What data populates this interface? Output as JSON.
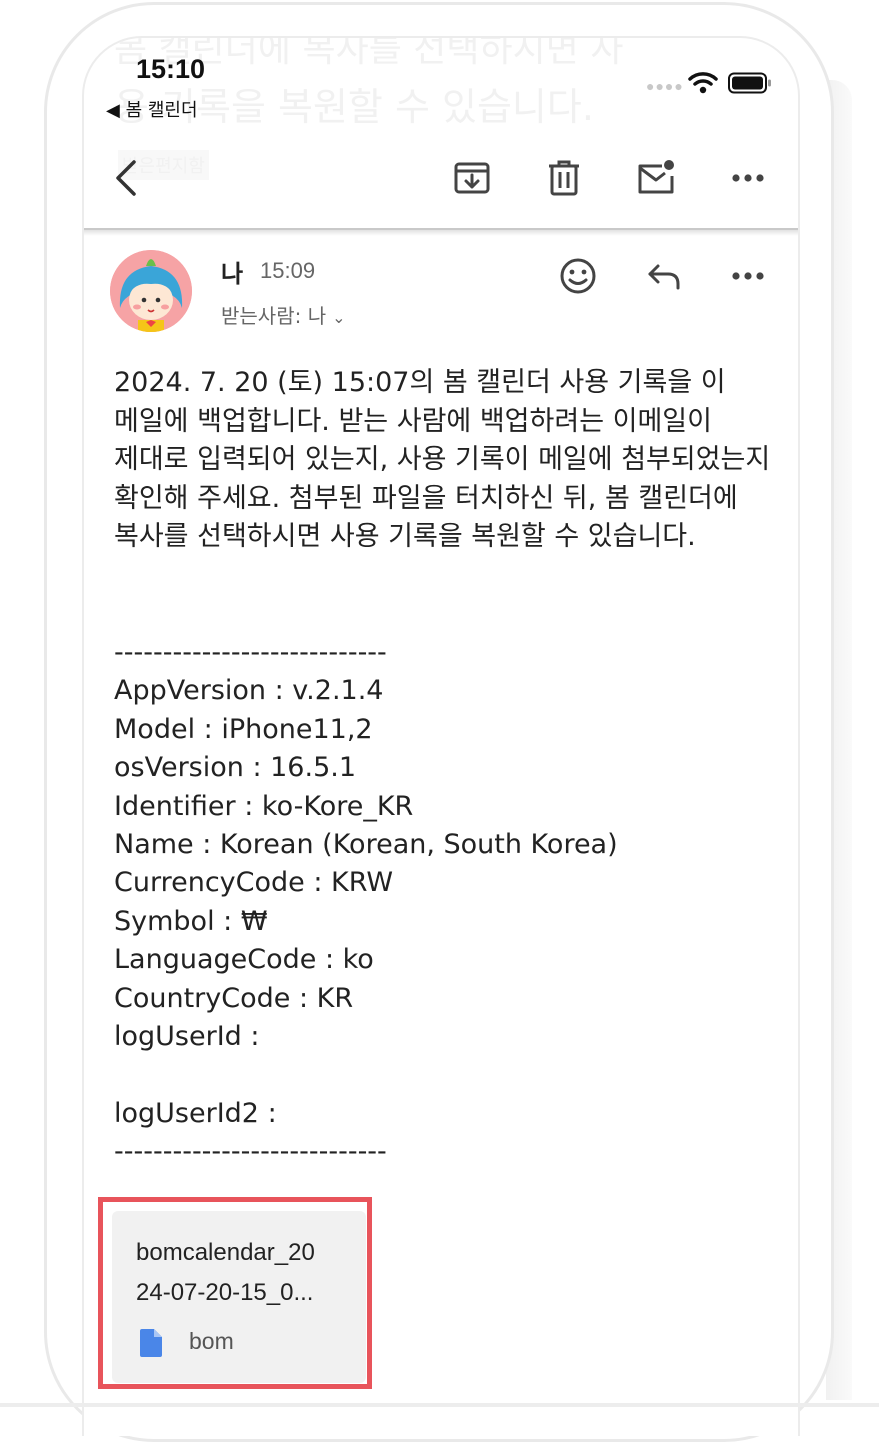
{
  "status": {
    "time": "15:10",
    "back_label": "◀ 봄 캘린더"
  },
  "background_preview": {
    "line1": "봄 캘린더에 복사를 선택하시면 사",
    "line2": "용 기록을 복원할 수 있습니다.",
    "line3": "받은편지함"
  },
  "toolbar": {
    "back_icon": "chevron-left-icon",
    "archive_icon": "archive-icon",
    "delete_icon": "trash-icon",
    "unread_icon": "mark-unread-icon",
    "more_icon": "more-horizontal-icon"
  },
  "message": {
    "sender": "나",
    "time": "15:09",
    "recipient": "받는사람: 나",
    "body": "2024. 7. 20 (토) 15:07의 봄 캘린더 사용 기록을 이 메일에 백업합니다. 받는 사람에 백업하려는 이메일이 제대로 입력되어 있는지, 사용 기록이 메일에 첨부되었는지 확인해 주세요. 첨부된 파일을 터치하신 뒤, 봄 캘린더에 복사를 선택하시면 사용 기록을 복원할 수 있습니다.",
    "info_lines": [
      "----------------------------",
      "AppVersion : v.2.1.4",
      "Model : iPhone11,2",
      "osVersion : 16.5.1",
      "Identifier : ko-Kore_KR",
      "Name : Korean (Korean, South Korea)",
      "CurrencyCode : KRW",
      "Symbol : ₩",
      "LanguageCode : ko",
      "CountryCode : KR",
      "logUserId :",
      "",
      "logUserId2 :",
      "----------------------------"
    ]
  },
  "attachment": {
    "name_line1": "bomcalendar_20",
    "name_line2": "24-07-20-15_0...",
    "type": "bom",
    "highlight_color": "#e8545b"
  },
  "colors": {
    "accent_blue": "#4a86e8",
    "highlight": "#e8545b",
    "avatar_bg": "#f6a3a5"
  }
}
